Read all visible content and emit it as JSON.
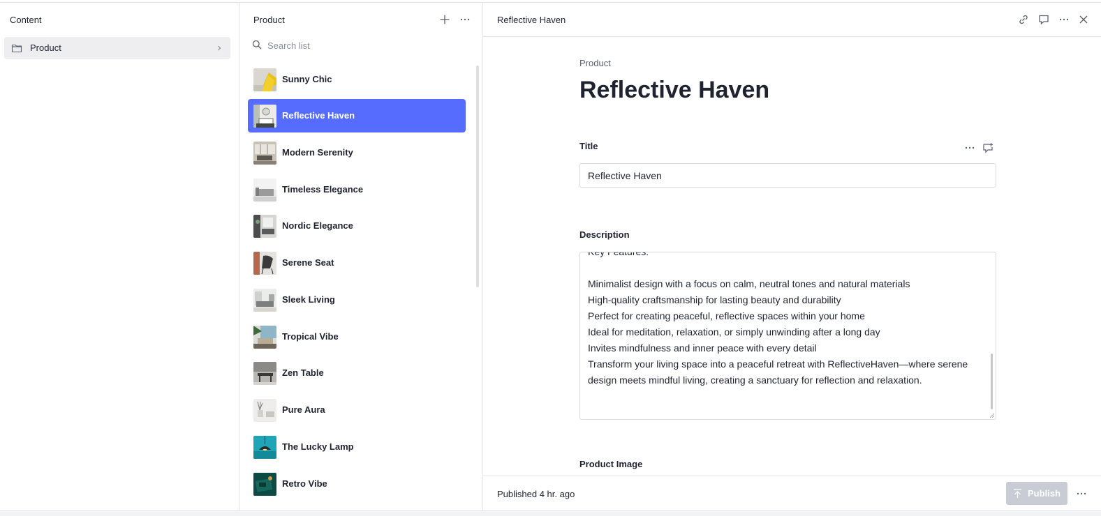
{
  "pane_content": {
    "title": "Content",
    "items": [
      {
        "label": "Product"
      }
    ]
  },
  "pane_list": {
    "title": "Product",
    "search_placeholder": "Search list",
    "items": [
      {
        "label": "Sunny Chic"
      },
      {
        "label": "Reflective Haven",
        "selected": true
      },
      {
        "label": "Modern Serenity"
      },
      {
        "label": "Timeless Elegance"
      },
      {
        "label": "Nordic Elegance"
      },
      {
        "label": "Serene Seat"
      },
      {
        "label": "Sleek Living"
      },
      {
        "label": "Tropical Vibe"
      },
      {
        "label": "Zen Table"
      },
      {
        "label": "Pure Aura"
      },
      {
        "label": "The Lucky Lamp"
      },
      {
        "label": "Retro Vibe"
      }
    ]
  },
  "document": {
    "header_title": "Reflective Haven",
    "type_label": "Product",
    "title": "Reflective Haven",
    "fields": {
      "title_label": "Title",
      "title_value": "Reflective Haven",
      "description_label": "Description",
      "description_value": "Key Features:\n\nMinimalist design with a focus on calm, neutral tones and natural materials\nHigh-quality craftsmanship for lasting beauty and durability\nPerfect for creating peaceful, reflective spaces within your home\nIdeal for meditation, relaxation, or simply unwinding after a long day\nInvites mindfulness and inner peace with every detail\nTransform your living space into a peaceful retreat with ReflectiveHaven—where serene design meets mindful living, creating a sanctuary for reflection and relaxation.",
      "image_label": "Product Image"
    }
  },
  "footer": {
    "status": "Published 4 hr. ago",
    "publish_label": "Publish"
  },
  "colors": {
    "accent": "#556cff",
    "border": "#e3e4e8",
    "text": "#1f2330",
    "muted": "#8a8f9c",
    "publish_disabled": "#c9ccd4"
  }
}
